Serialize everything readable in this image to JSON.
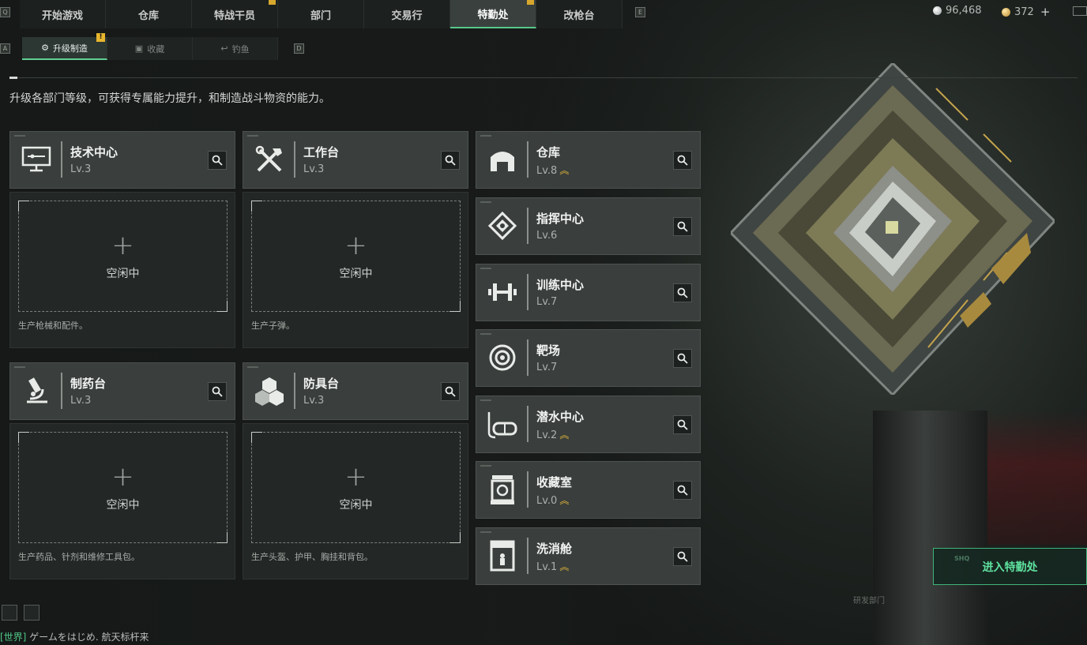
{
  "nav": {
    "left_key": "Q",
    "right_key": "E",
    "tabs": [
      {
        "label": "开始游戏",
        "active": false,
        "badge": false
      },
      {
        "label": "仓库",
        "active": false,
        "badge": false
      },
      {
        "label": "特战干员",
        "active": false,
        "badge": true
      },
      {
        "label": "部门",
        "active": false,
        "badge": false
      },
      {
        "label": "交易行",
        "active": false,
        "badge": false
      },
      {
        "label": "特勤处",
        "active": true,
        "badge": true
      },
      {
        "label": "改枪台",
        "active": false,
        "badge": false
      }
    ]
  },
  "currency": {
    "silver": "96,468",
    "gold": "372",
    "add_label": "+"
  },
  "subnav": {
    "left_key": "A",
    "right_key": "D",
    "tabs": [
      {
        "label": "升级制造",
        "icon": "gear-build-icon",
        "active": true,
        "warn": "!"
      },
      {
        "label": "收藏",
        "icon": "collection-icon",
        "active": false
      },
      {
        "label": "钓鱼",
        "icon": "fishing-icon",
        "active": false
      }
    ]
  },
  "description": "升级各部门等级，可获得专属能力提升，和制造战斗物资的能力。",
  "facilities": [
    {
      "name": "技术中心",
      "level": "Lv.3",
      "icon": "monitor-icon",
      "slot_plus": "+",
      "slot_status": "空闲中",
      "note": "生产枪械和配件。"
    },
    {
      "name": "工作台",
      "level": "Lv.3",
      "icon": "tools-icon",
      "slot_plus": "+",
      "slot_status": "空闲中",
      "note": "生产子弹。"
    },
    {
      "name": "制药台",
      "level": "Lv.3",
      "icon": "microscope-icon",
      "slot_plus": "+",
      "slot_status": "空闲中",
      "note": "生产药品、针剂和维修工具包。"
    },
    {
      "name": "防具台",
      "level": "Lv.3",
      "icon": "cubes-icon",
      "slot_plus": "+",
      "slot_status": "空闲中",
      "note": "生产头盔、护甲、胸挂和背包。"
    }
  ],
  "departments": [
    {
      "name": "仓库",
      "level": "Lv.8",
      "icon": "warehouse-icon",
      "upgradable": true
    },
    {
      "name": "指挥中心",
      "level": "Lv.6",
      "icon": "command-icon",
      "upgradable": false
    },
    {
      "name": "训练中心",
      "level": "Lv.7",
      "icon": "dumbbell-icon",
      "upgradable": false
    },
    {
      "name": "靶场",
      "level": "Lv.7",
      "icon": "target-icon",
      "upgradable": false
    },
    {
      "name": "潜水中心",
      "level": "Lv.2",
      "icon": "diving-mask-icon",
      "upgradable": true
    },
    {
      "name": "收藏室",
      "level": "Lv.0",
      "icon": "vault-icon",
      "upgradable": true
    },
    {
      "name": "洗消舱",
      "level": "Lv.1",
      "icon": "decon-pod-icon",
      "upgradable": true
    }
  ],
  "enter_button": {
    "label": "进入特勤处",
    "tag": "SHQ"
  },
  "department_stamp": "研发部门",
  "chat": {
    "channel": "[世界]",
    "message": "ゲームをはじめ. 航天标杆来"
  },
  "colors": {
    "accent": "#57c98b",
    "upgrade": "#e0b53a",
    "warning": "#e7b52e"
  }
}
